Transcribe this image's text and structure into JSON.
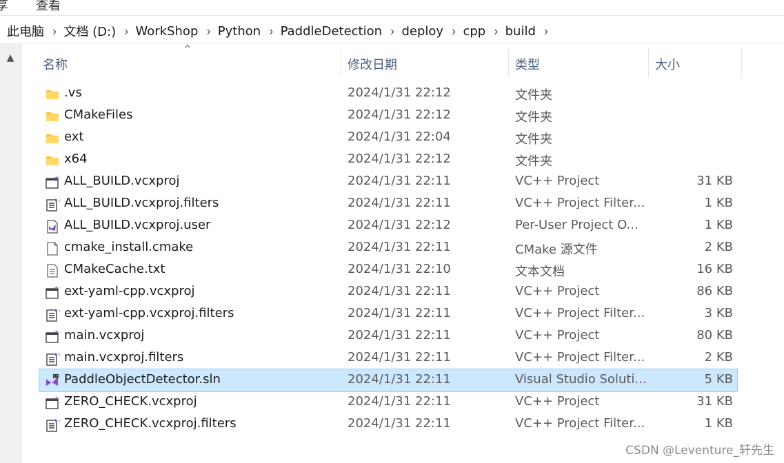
{
  "ribbon": {
    "tab_share": "享",
    "tab_view": "查看"
  },
  "breadcrumb": [
    "此电脑",
    "文档 (D:)",
    "WorkShop",
    "Python",
    "PaddleDetection",
    "deploy",
    "cpp",
    "build"
  ],
  "columns": {
    "name": "名称",
    "date": "修改日期",
    "type": "类型",
    "size": "大小"
  },
  "files": [
    {
      "name": ".vs",
      "date": "2024/1/31 22:12",
      "type": "文件夹",
      "size": "",
      "icon": "folder-icon"
    },
    {
      "name": "CMakeFiles",
      "date": "2024/1/31 22:12",
      "type": "文件夹",
      "size": "",
      "icon": "folder-icon"
    },
    {
      "name": "ext",
      "date": "2024/1/31 22:04",
      "type": "文件夹",
      "size": "",
      "icon": "folder-icon"
    },
    {
      "name": "x64",
      "date": "2024/1/31 22:12",
      "type": "文件夹",
      "size": "",
      "icon": "folder-icon"
    },
    {
      "name": "ALL_BUILD.vcxproj",
      "date": "2024/1/31 22:11",
      "type": "VC++ Project",
      "size": "31 KB",
      "icon": "vcxproj-icon"
    },
    {
      "name": "ALL_BUILD.vcxproj.filters",
      "date": "2024/1/31 22:11",
      "type": "VC++ Project Filter...",
      "size": "1 KB",
      "icon": "filters-icon"
    },
    {
      "name": "ALL_BUILD.vcxproj.user",
      "date": "2024/1/31 22:12",
      "type": "Per-User Project O...",
      "size": "1 KB",
      "icon": "user-file-icon"
    },
    {
      "name": "cmake_install.cmake",
      "date": "2024/1/31 22:11",
      "type": "CMake 源文件",
      "size": "2 KB",
      "icon": "document-icon"
    },
    {
      "name": "CMakeCache.txt",
      "date": "2024/1/31 22:10",
      "type": "文本文档",
      "size": "16 KB",
      "icon": "text-file-icon"
    },
    {
      "name": "ext-yaml-cpp.vcxproj",
      "date": "2024/1/31 22:11",
      "type": "VC++ Project",
      "size": "86 KB",
      "icon": "vcxproj-icon"
    },
    {
      "name": "ext-yaml-cpp.vcxproj.filters",
      "date": "2024/1/31 22:11",
      "type": "VC++ Project Filter...",
      "size": "3 KB",
      "icon": "filters-icon"
    },
    {
      "name": "main.vcxproj",
      "date": "2024/1/31 22:11",
      "type": "VC++ Project",
      "size": "80 KB",
      "icon": "vcxproj-icon"
    },
    {
      "name": "main.vcxproj.filters",
      "date": "2024/1/31 22:11",
      "type": "VC++ Project Filter...",
      "size": "2 KB",
      "icon": "filters-icon"
    },
    {
      "name": "PaddleObjectDetector.sln",
      "date": "2024/1/31 22:11",
      "type": "Visual Studio Soluti...",
      "size": "5 KB",
      "icon": "sln-icon",
      "selected": true
    },
    {
      "name": "ZERO_CHECK.vcxproj",
      "date": "2024/1/31 22:11",
      "type": "VC++ Project",
      "size": "31 KB",
      "icon": "vcxproj-icon"
    },
    {
      "name": "ZERO_CHECK.vcxproj.filters",
      "date": "2024/1/31 22:11",
      "type": "VC++ Project Filter...",
      "size": "1 KB",
      "icon": "filters-icon"
    }
  ],
  "watermark": "CSDN @Leventure_轩先生",
  "colors": {
    "selection": "#cce8ff",
    "selection_border": "#99d1ff",
    "folder": "#f4c542",
    "vs_purple": "#8a4fc7"
  }
}
